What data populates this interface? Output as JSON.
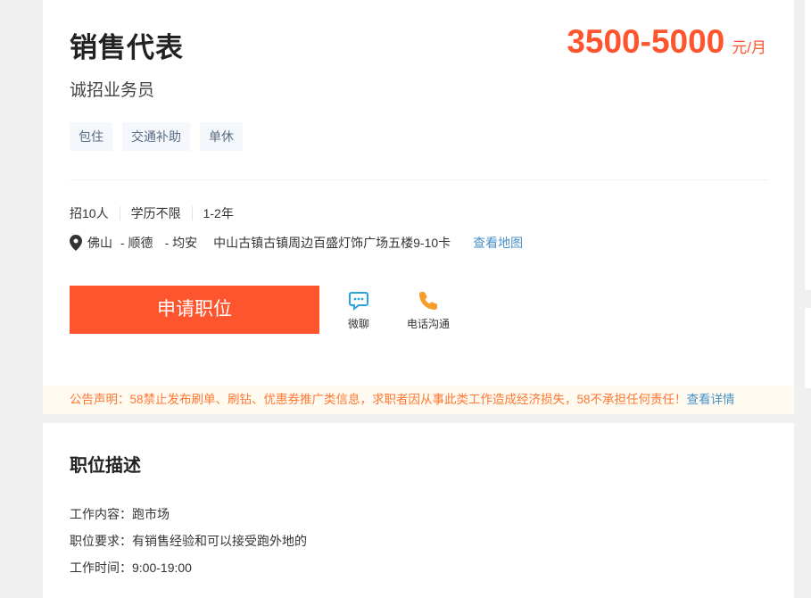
{
  "job": {
    "title": "销售代表",
    "salary": "3500-5000",
    "salary_unit": "元/月",
    "subtitle": "诚招业务员",
    "tags": [
      "包住",
      "交通补助",
      "单休"
    ],
    "meta": [
      "招10人",
      "学历不限",
      "1-2年"
    ],
    "address": {
      "city": "佛山",
      "district": "- 顺德",
      "area": "- 均安",
      "street": "中山古镇古镇周边百盛灯饰广场五楼9-10卡",
      "map_link": "查看地图"
    }
  },
  "actions": {
    "apply_label": "申请职位",
    "wechat_label": "微聊",
    "phone_label": "电话沟通"
  },
  "notice": {
    "text": "公告声明：58禁止发布刷单、刷钻、优惠券推广类信息，求职者因从事此类工作造成经济损失，58不承担任何责任！",
    "more": "查看详情"
  },
  "description": {
    "section_title": "职位描述",
    "lines": [
      "工作内容：跑市场",
      "职位要求：有销售经验和可以接受跑外地的",
      "工作时间：9:00-19:00"
    ]
  },
  "colors": {
    "accent": "#ff552e",
    "link": "#4a90c9",
    "notice_text": "#ff7733"
  }
}
